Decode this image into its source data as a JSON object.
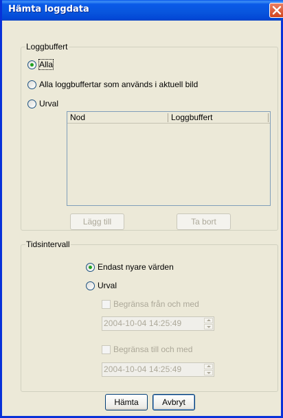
{
  "window": {
    "title": "Hämta loggdata"
  },
  "log_buffer": {
    "group_title": "Loggbuffert",
    "options": [
      {
        "label": "Alla",
        "checked": true
      },
      {
        "label": "Alla loggbuffertar som används i aktuell bild",
        "checked": false
      },
      {
        "label": "Urval",
        "checked": false
      }
    ],
    "table": {
      "columns": [
        "Nod",
        "Loggbuffert"
      ],
      "rows": []
    },
    "add_label": "Lägg till",
    "remove_label": "Ta bort"
  },
  "time_interval": {
    "group_title": "Tidsintervall",
    "options": [
      {
        "label": "Endast nyare värden",
        "checked": true
      },
      {
        "label": "Urval",
        "checked": false
      }
    ],
    "from_checkbox_label": "Begränsa från och med",
    "from_value": "2004-10-04  14:25:49",
    "to_checkbox_label": "Begränsa till och med",
    "to_value": "2004-10-04  14:25:49"
  },
  "footer": {
    "ok_label": "Hämta",
    "cancel_label": "Avbryt"
  },
  "icons": {
    "close": "close-icon"
  }
}
